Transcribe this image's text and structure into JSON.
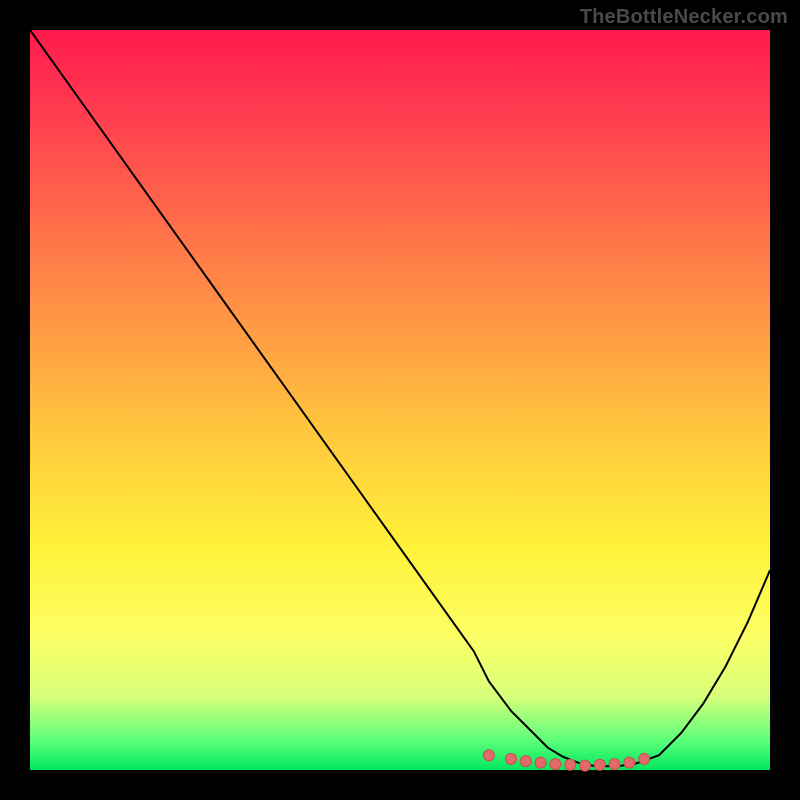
{
  "watermark": "TheBottleNecker.com",
  "colors": {
    "frame": "#000000",
    "curve": "#000000",
    "marker": "#e36a6a",
    "marker_stroke": "#c94f4f"
  },
  "chart_data": {
    "type": "line",
    "title": "",
    "xlabel": "",
    "ylabel": "",
    "xlim": [
      0,
      100
    ],
    "ylim": [
      0,
      100
    ],
    "series": [
      {
        "name": "bottleneck-curve",
        "x": [
          0,
          5,
          10,
          15,
          20,
          25,
          30,
          35,
          40,
          45,
          50,
          55,
          60,
          62,
          65,
          68,
          70,
          72,
          74,
          76,
          78,
          80,
          82,
          85,
          88,
          91,
          94,
          97,
          100
        ],
        "values": [
          100,
          93,
          86,
          79,
          72,
          65,
          58,
          51,
          44,
          37,
          30,
          23,
          16,
          12,
          8,
          5,
          3,
          1.8,
          1.0,
          0.6,
          0.5,
          0.6,
          0.9,
          2,
          5,
          9,
          14,
          20,
          27
        ]
      }
    ],
    "markers": {
      "x": [
        62,
        65,
        67,
        69,
        71,
        73,
        75,
        77,
        79,
        81,
        83
      ],
      "values": [
        2,
        1.5,
        1.2,
        1.0,
        0.8,
        0.7,
        0.6,
        0.7,
        0.8,
        1.0,
        1.5
      ]
    },
    "annotations": []
  }
}
